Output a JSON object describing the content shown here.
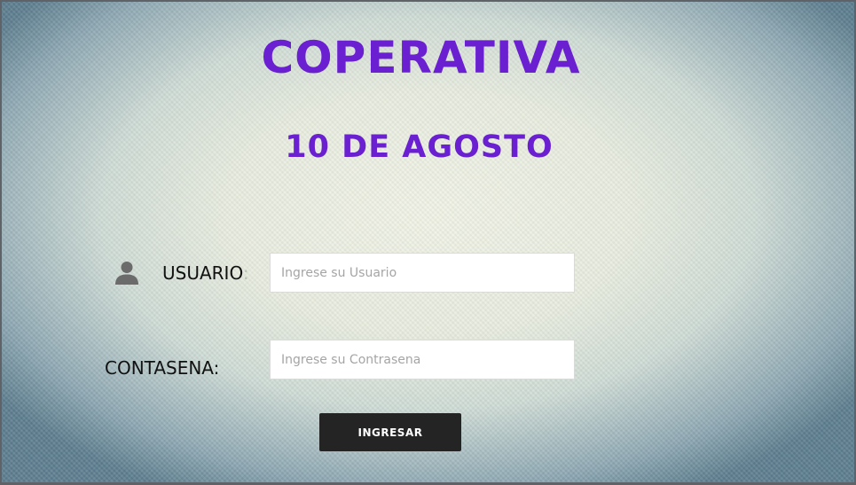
{
  "header": {
    "title": "COPERATIVA",
    "subtitle": "10 DE AGOSTO"
  },
  "form": {
    "user_label": "USUARIO",
    "user_colon": ":",
    "user_placeholder": "Ingrese su Usuario",
    "user_value": "",
    "password_label": "CONTASENA:",
    "password_placeholder": "Ingrese su Contrasena",
    "password_value": "",
    "submit_label": "INGRESAR"
  },
  "icons": {
    "user": "user-icon"
  },
  "colors": {
    "title": "#6a1fd0",
    "button_bg": "#242424",
    "button_text": "#ffffff",
    "icon": "#6b6b6b"
  }
}
